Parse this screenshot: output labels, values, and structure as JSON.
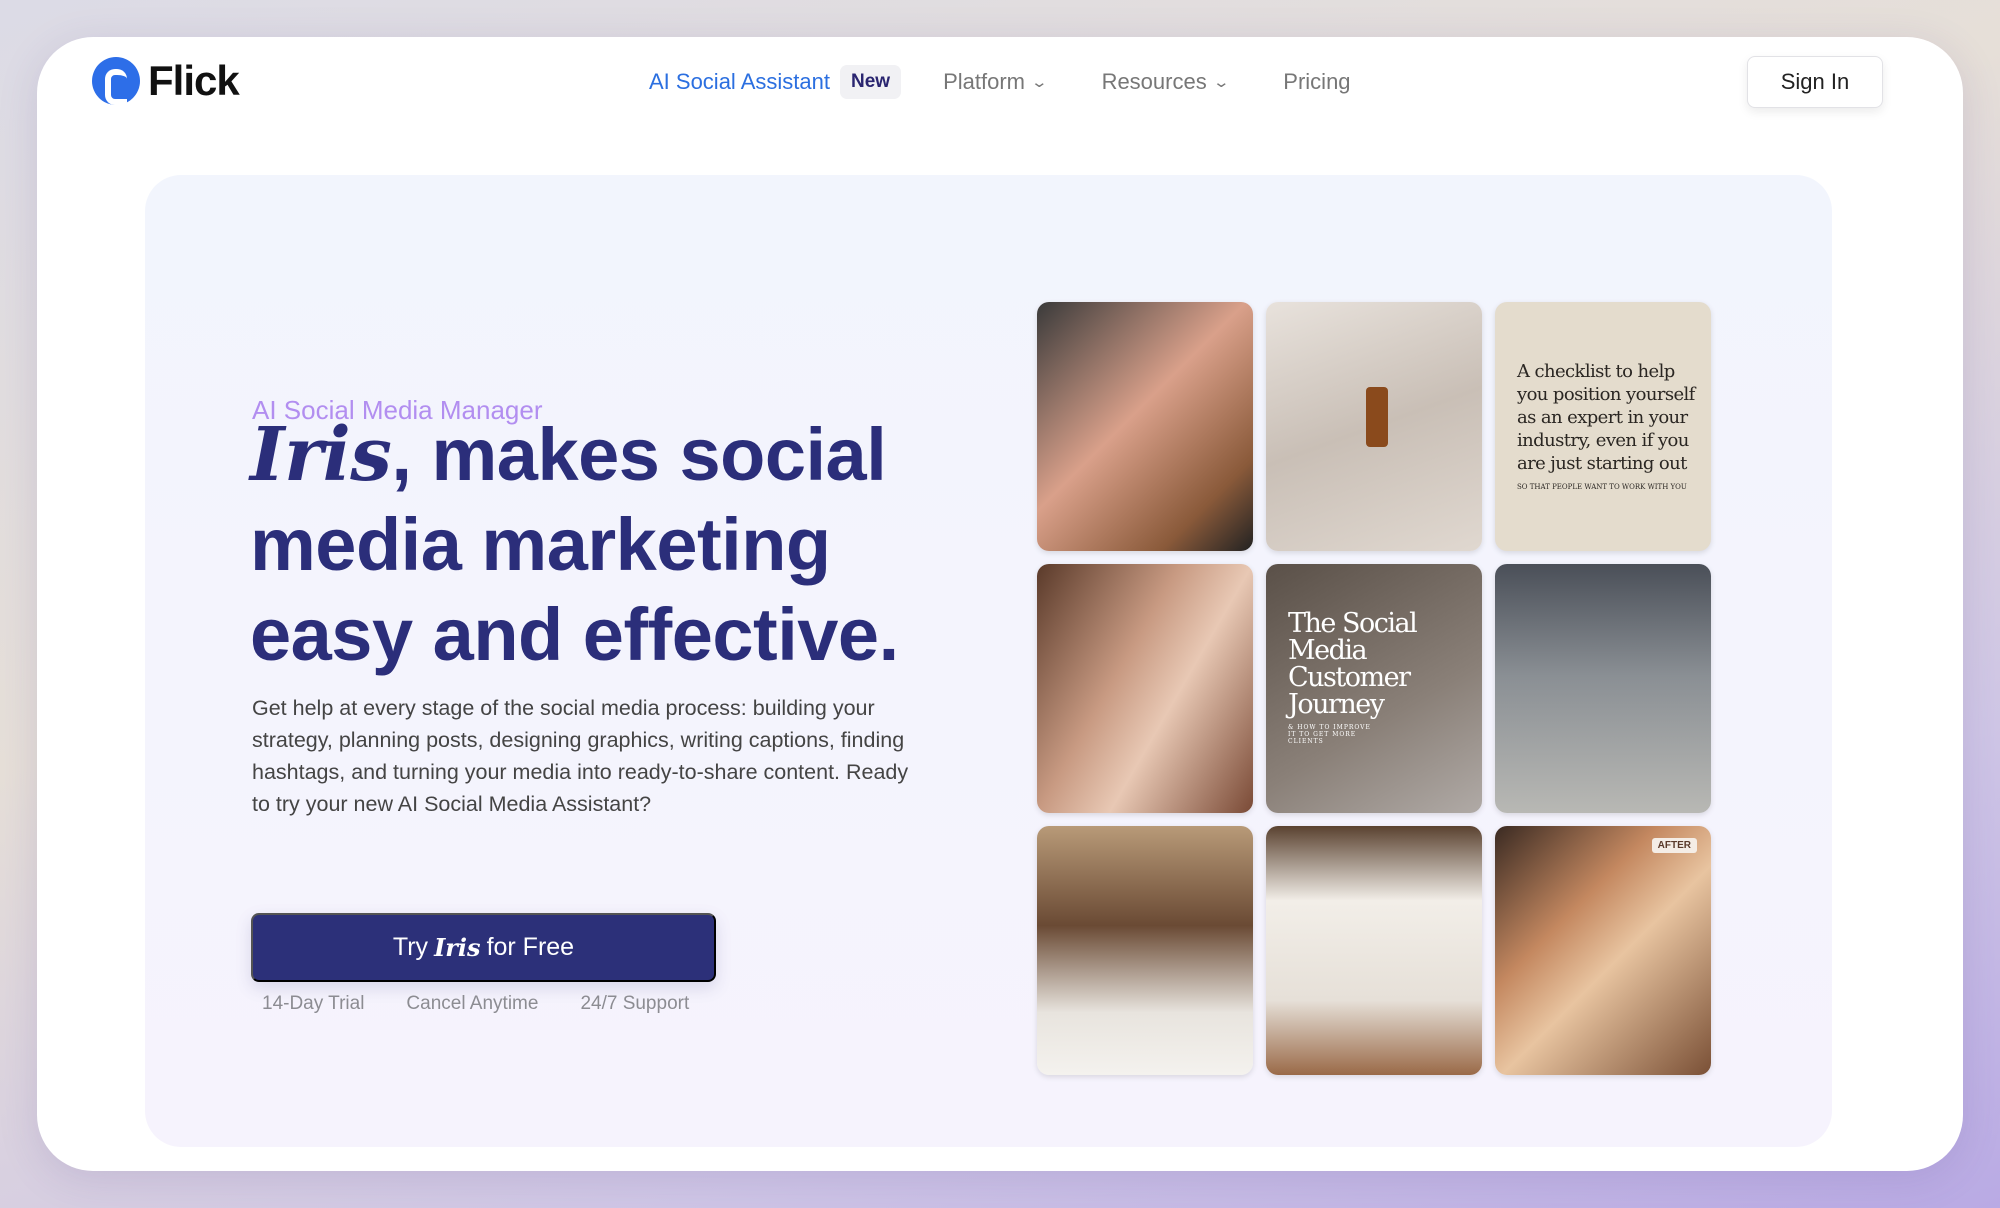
{
  "nav": {
    "brand": "Flick",
    "items": [
      {
        "label": "AI Social Assistant",
        "badge": "New"
      },
      {
        "label": "Platform"
      },
      {
        "label": "Resources"
      },
      {
        "label": "Pricing"
      }
    ],
    "sign_in": "Sign In"
  },
  "colors": {
    "accent": "#2c3079",
    "link": "#2b6fe0",
    "eyebrow": "#b28ef0"
  },
  "hero": {
    "eyebrow": "AI Social Media Manager",
    "headline_name": "Iris",
    "headline_rest": ", makes social media marketing easy and effective.",
    "body": "Get help at every stage of the social media process: building your strategy, planning posts, designing graphics, writing captions, finding hashtags, and turning your media into ready-to-share content. Ready to try your new AI Social Media Assistant?",
    "cta": {
      "pre": "Try",
      "name": "Iris",
      "post": "for Free"
    },
    "notes": [
      "14-Day Trial",
      "Cancel Anytime",
      "24/7 Support"
    ]
  },
  "gallery": {
    "checklist_title": "A checklist to help you position yourself as an expert in your industry, even if you are just starting out",
    "checklist_sub": "SO THAT PEOPLE WANT TO WORK WITH YOU",
    "journey_title": "The Social Media Customer Journey",
    "journey_sub": "& HOW TO IMPROVE IT TO GET MORE CLIENTS",
    "after_label": "AFTER"
  }
}
